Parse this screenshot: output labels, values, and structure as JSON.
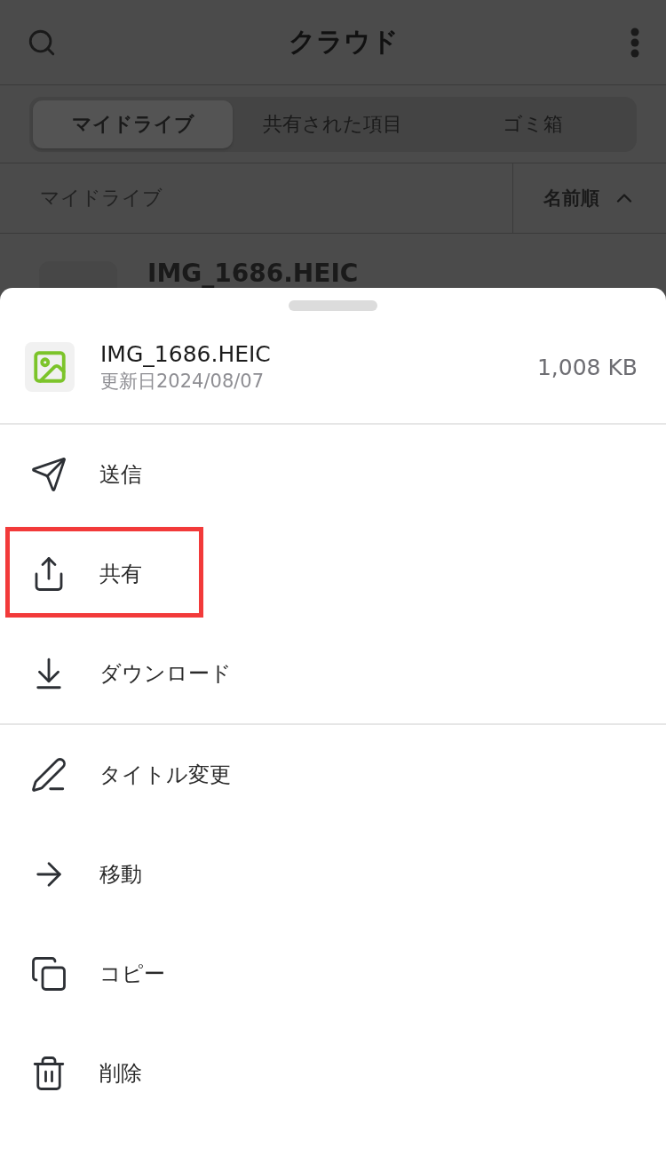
{
  "header": {
    "title": "クラウド"
  },
  "tabs": [
    {
      "label": "マイドライブ",
      "selected": true
    },
    {
      "label": "共有された項目",
      "selected": false
    },
    {
      "label": "ゴミ箱",
      "selected": false
    }
  ],
  "breadcrumb": {
    "path": "マイドライブ",
    "sort": "名前順"
  },
  "background_file": {
    "name": "IMG_1686.HEIC"
  },
  "sheet": {
    "file": {
      "name": "IMG_1686.HEIC",
      "modified": "更新日2024/08/07",
      "size": "1,008 KB"
    },
    "groups": [
      [
        {
          "kind": "send",
          "label": "送信",
          "highlighted": false
        },
        {
          "kind": "share",
          "label": "共有",
          "highlighted": true
        },
        {
          "kind": "download",
          "label": "ダウンロード",
          "highlighted": false
        }
      ],
      [
        {
          "kind": "rename",
          "label": "タイトル変更",
          "highlighted": false
        },
        {
          "kind": "move",
          "label": "移動",
          "highlighted": false
        },
        {
          "kind": "copy",
          "label": "コピー",
          "highlighted": false
        },
        {
          "kind": "delete",
          "label": "削除",
          "highlighted": false
        }
      ]
    ]
  }
}
